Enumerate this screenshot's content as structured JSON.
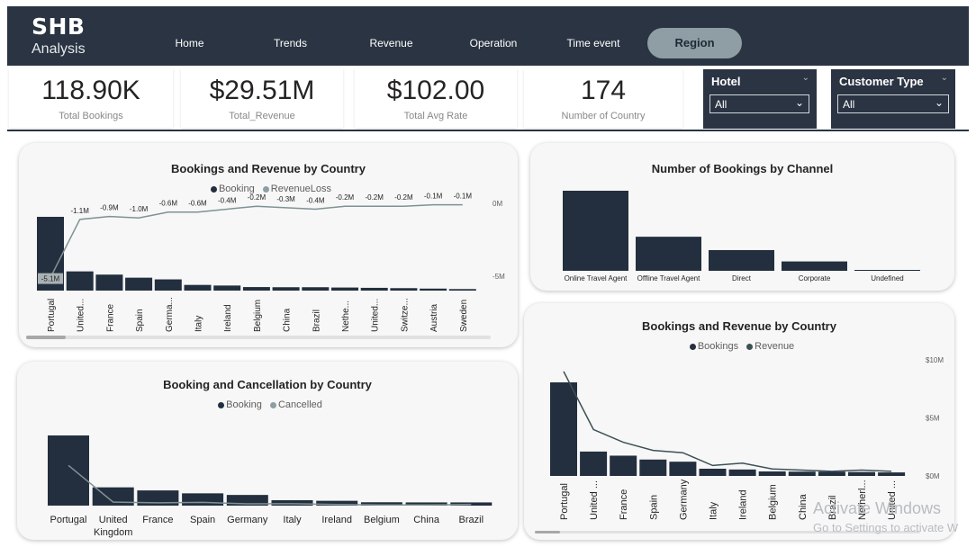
{
  "header": {
    "title": "SHB",
    "subtitle": "Analysis",
    "nav": [
      "Home",
      "Trends",
      "Revenue",
      "Operation",
      "Time event",
      "Region"
    ],
    "active_nav": "Region"
  },
  "kpis": [
    {
      "value": "118.90K",
      "label": "Total Bookings"
    },
    {
      "value": "$29.51M",
      "label": "Total_Revenue"
    },
    {
      "value": "$102.00",
      "label": "Total Avg Rate"
    },
    {
      "value": "174",
      "label": "Number of Country"
    }
  ],
  "slicers": [
    {
      "title": "Hotel",
      "value": "All"
    },
    {
      "title": "Customer Type",
      "value": "All"
    }
  ],
  "colors": {
    "bar": "#232f3e",
    "line": "#7f9293",
    "header": "#2a3442",
    "active_nav": "#8e9ea4"
  },
  "chart_data": [
    {
      "type": "bar",
      "title": "Bookings and Revenue by Country",
      "legend": [
        "Booking",
        "RevenueLoss"
      ],
      "categories": [
        "Portugal",
        "United...",
        "France",
        "Spain",
        "Germa...",
        "Italy",
        "Ireland",
        "Belgium",
        "China",
        "Brazil",
        "Nethe...",
        "United...",
        "Switze...",
        "Austria",
        "Sweden"
      ],
      "series": [
        {
          "name": "Booking",
          "values": [
            48000,
            12500,
            10400,
            8400,
            7300,
            3700,
            3300,
            2300,
            2200,
            2200,
            2000,
            1800,
            1600,
            1300,
            1000
          ]
        },
        {
          "name": "RevenueLoss",
          "values": [
            -5.1,
            -1.1,
            -0.9,
            -1.0,
            -0.6,
            -0.6,
            -0.4,
            -0.2,
            -0.3,
            -0.4,
            -0.2,
            -0.2,
            -0.2,
            -0.1,
            -0.1
          ]
        }
      ],
      "data_labels": [
        "-5.1M",
        "-1.1M",
        "-0.9M",
        "-1.0M",
        "-0.6M",
        "-0.6M",
        "-0.4M",
        "-0.2M",
        "-0.3M",
        "-0.4M",
        "-0.2M",
        "-0.2M",
        "-0.2M",
        "-0.1M",
        "-0.1M"
      ],
      "y2_ticks": [
        "0M",
        "-5M"
      ],
      "y2lim": [
        -5,
        0
      ]
    },
    {
      "type": "bar",
      "title": "Number of Bookings by Channel",
      "categories": [
        "Online Travel Agent",
        "Offline Travel Agent",
        "Direct",
        "Corporate",
        "Undefined"
      ],
      "values": [
        56400,
        24000,
        14600,
        6600,
        5
      ]
    },
    {
      "type": "bar",
      "title": "Booking and Cancellation by Country",
      "legend": [
        "Booking",
        "Cancelled"
      ],
      "categories": [
        "Portugal",
        "United Kingdom",
        "France",
        "Spain",
        "Germany",
        "Italy",
        "Ireland",
        "Belgium",
        "China",
        "Brazil"
      ],
      "series": [
        {
          "name": "Booking",
          "values": [
            48000,
            12500,
            10400,
            8400,
            7300,
            3700,
            3300,
            2300,
            2200,
            2200
          ]
        },
        {
          "name": "Cancelled",
          "values": [
            27500,
            2400,
            1900,
            2200,
            1200,
            1300,
            800,
            470,
            460,
            830
          ]
        }
      ]
    },
    {
      "type": "bar",
      "title": "Bookings and Revenue by Country",
      "legend": [
        "Bookings",
        "Revenue"
      ],
      "categories": [
        "Portugal",
        "United ...",
        "France",
        "Spain",
        "Germany",
        "Italy",
        "Ireland",
        "Belgium",
        "China",
        "Brazil",
        "Netherl...",
        "United ..."
      ],
      "series": [
        {
          "name": "Bookings",
          "values": [
            48000,
            12500,
            10400,
            8400,
            7300,
            3700,
            3300,
            2300,
            2200,
            2200,
            2000,
            1800
          ]
        },
        {
          "name": "Revenue",
          "values": [
            9.0,
            4.0,
            2.9,
            2.2,
            2.0,
            0.9,
            1.1,
            0.6,
            0.5,
            0.4,
            0.5,
            0.4
          ]
        }
      ],
      "y2_ticks": [
        "$10M",
        "$5M",
        "$0M"
      ],
      "y2lim": [
        0,
        10
      ]
    }
  ],
  "watermark": {
    "line1": "Activate Windows",
    "line2": "Go to Settings to activate W"
  }
}
